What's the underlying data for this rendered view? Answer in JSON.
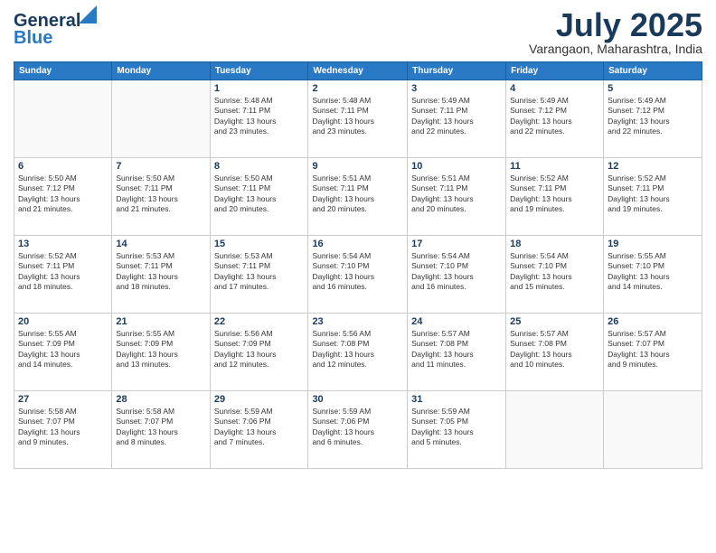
{
  "logo": {
    "line1": "General",
    "line2": "Blue"
  },
  "title": {
    "month_year": "July 2025",
    "location": "Varangaon, Maharashtra, India"
  },
  "weekdays": [
    "Sunday",
    "Monday",
    "Tuesday",
    "Wednesday",
    "Thursday",
    "Friday",
    "Saturday"
  ],
  "weeks": [
    [
      {
        "day": "",
        "info": ""
      },
      {
        "day": "",
        "info": ""
      },
      {
        "day": "1",
        "info": "Sunrise: 5:48 AM\nSunset: 7:11 PM\nDaylight: 13 hours\nand 23 minutes."
      },
      {
        "day": "2",
        "info": "Sunrise: 5:48 AM\nSunset: 7:11 PM\nDaylight: 13 hours\nand 23 minutes."
      },
      {
        "day": "3",
        "info": "Sunrise: 5:49 AM\nSunset: 7:11 PM\nDaylight: 13 hours\nand 22 minutes."
      },
      {
        "day": "4",
        "info": "Sunrise: 5:49 AM\nSunset: 7:12 PM\nDaylight: 13 hours\nand 22 minutes."
      },
      {
        "day": "5",
        "info": "Sunrise: 5:49 AM\nSunset: 7:12 PM\nDaylight: 13 hours\nand 22 minutes."
      }
    ],
    [
      {
        "day": "6",
        "info": "Sunrise: 5:50 AM\nSunset: 7:12 PM\nDaylight: 13 hours\nand 21 minutes."
      },
      {
        "day": "7",
        "info": "Sunrise: 5:50 AM\nSunset: 7:11 PM\nDaylight: 13 hours\nand 21 minutes."
      },
      {
        "day": "8",
        "info": "Sunrise: 5:50 AM\nSunset: 7:11 PM\nDaylight: 13 hours\nand 20 minutes."
      },
      {
        "day": "9",
        "info": "Sunrise: 5:51 AM\nSunset: 7:11 PM\nDaylight: 13 hours\nand 20 minutes."
      },
      {
        "day": "10",
        "info": "Sunrise: 5:51 AM\nSunset: 7:11 PM\nDaylight: 13 hours\nand 20 minutes."
      },
      {
        "day": "11",
        "info": "Sunrise: 5:52 AM\nSunset: 7:11 PM\nDaylight: 13 hours\nand 19 minutes."
      },
      {
        "day": "12",
        "info": "Sunrise: 5:52 AM\nSunset: 7:11 PM\nDaylight: 13 hours\nand 19 minutes."
      }
    ],
    [
      {
        "day": "13",
        "info": "Sunrise: 5:52 AM\nSunset: 7:11 PM\nDaylight: 13 hours\nand 18 minutes."
      },
      {
        "day": "14",
        "info": "Sunrise: 5:53 AM\nSunset: 7:11 PM\nDaylight: 13 hours\nand 18 minutes."
      },
      {
        "day": "15",
        "info": "Sunrise: 5:53 AM\nSunset: 7:11 PM\nDaylight: 13 hours\nand 17 minutes."
      },
      {
        "day": "16",
        "info": "Sunrise: 5:54 AM\nSunset: 7:10 PM\nDaylight: 13 hours\nand 16 minutes."
      },
      {
        "day": "17",
        "info": "Sunrise: 5:54 AM\nSunset: 7:10 PM\nDaylight: 13 hours\nand 16 minutes."
      },
      {
        "day": "18",
        "info": "Sunrise: 5:54 AM\nSunset: 7:10 PM\nDaylight: 13 hours\nand 15 minutes."
      },
      {
        "day": "19",
        "info": "Sunrise: 5:55 AM\nSunset: 7:10 PM\nDaylight: 13 hours\nand 14 minutes."
      }
    ],
    [
      {
        "day": "20",
        "info": "Sunrise: 5:55 AM\nSunset: 7:09 PM\nDaylight: 13 hours\nand 14 minutes."
      },
      {
        "day": "21",
        "info": "Sunrise: 5:55 AM\nSunset: 7:09 PM\nDaylight: 13 hours\nand 13 minutes."
      },
      {
        "day": "22",
        "info": "Sunrise: 5:56 AM\nSunset: 7:09 PM\nDaylight: 13 hours\nand 12 minutes."
      },
      {
        "day": "23",
        "info": "Sunrise: 5:56 AM\nSunset: 7:08 PM\nDaylight: 13 hours\nand 12 minutes."
      },
      {
        "day": "24",
        "info": "Sunrise: 5:57 AM\nSunset: 7:08 PM\nDaylight: 13 hours\nand 11 minutes."
      },
      {
        "day": "25",
        "info": "Sunrise: 5:57 AM\nSunset: 7:08 PM\nDaylight: 13 hours\nand 10 minutes."
      },
      {
        "day": "26",
        "info": "Sunrise: 5:57 AM\nSunset: 7:07 PM\nDaylight: 13 hours\nand 9 minutes."
      }
    ],
    [
      {
        "day": "27",
        "info": "Sunrise: 5:58 AM\nSunset: 7:07 PM\nDaylight: 13 hours\nand 9 minutes."
      },
      {
        "day": "28",
        "info": "Sunrise: 5:58 AM\nSunset: 7:07 PM\nDaylight: 13 hours\nand 8 minutes."
      },
      {
        "day": "29",
        "info": "Sunrise: 5:59 AM\nSunset: 7:06 PM\nDaylight: 13 hours\nand 7 minutes."
      },
      {
        "day": "30",
        "info": "Sunrise: 5:59 AM\nSunset: 7:06 PM\nDaylight: 13 hours\nand 6 minutes."
      },
      {
        "day": "31",
        "info": "Sunrise: 5:59 AM\nSunset: 7:05 PM\nDaylight: 13 hours\nand 5 minutes."
      },
      {
        "day": "",
        "info": ""
      },
      {
        "day": "",
        "info": ""
      }
    ]
  ]
}
